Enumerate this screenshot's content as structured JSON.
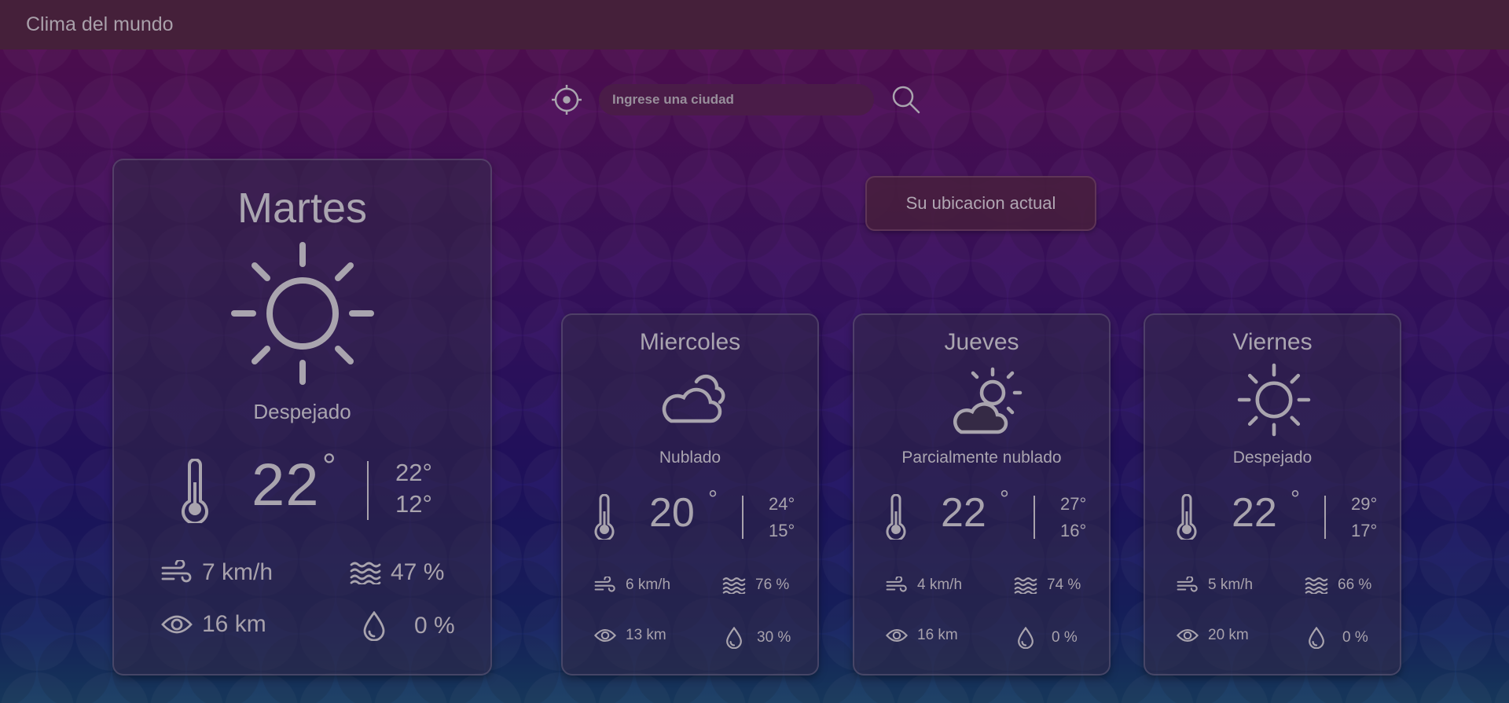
{
  "app": {
    "title": "Clima del mundo"
  },
  "search": {
    "placeholder": "Ingrese una ciudad"
  },
  "location_button": "Su ubicacion actual",
  "colors": {
    "background_top": "#6a0a63",
    "background_bottom": "#124d7a",
    "text": "#a9a4ae",
    "topbar": "#45203a"
  },
  "today": {
    "day": "Martes",
    "icon": "sun-icon",
    "condition": "Despejado",
    "temp": "22",
    "degree": "°",
    "high": "22°",
    "low": "12°",
    "wind": "7 km/h",
    "humidity": "47 %",
    "visibility": "16 km",
    "rain": "0 %"
  },
  "forecast": [
    {
      "day": "Miercoles",
      "icon": "cloudy-icon",
      "condition": "Nublado",
      "temp": "20",
      "degree": "°",
      "high": "24°",
      "low": "15°",
      "wind": "6 km/h",
      "humidity": "76 %",
      "visibility": "13 km",
      "rain": "30 %"
    },
    {
      "day": "Jueves",
      "icon": "partly-cloudy-icon",
      "condition": "Parcialmente nublado",
      "temp": "22",
      "degree": "°",
      "high": "27°",
      "low": "16°",
      "wind": "4 km/h",
      "humidity": "74 %",
      "visibility": "16 km",
      "rain": "0 %"
    },
    {
      "day": "Viernes",
      "icon": "sun-icon",
      "condition": "Despejado",
      "temp": "22",
      "degree": "°",
      "high": "29°",
      "low": "17°",
      "wind": "5 km/h",
      "humidity": "66 %",
      "visibility": "20 km",
      "rain": "0 %"
    }
  ]
}
